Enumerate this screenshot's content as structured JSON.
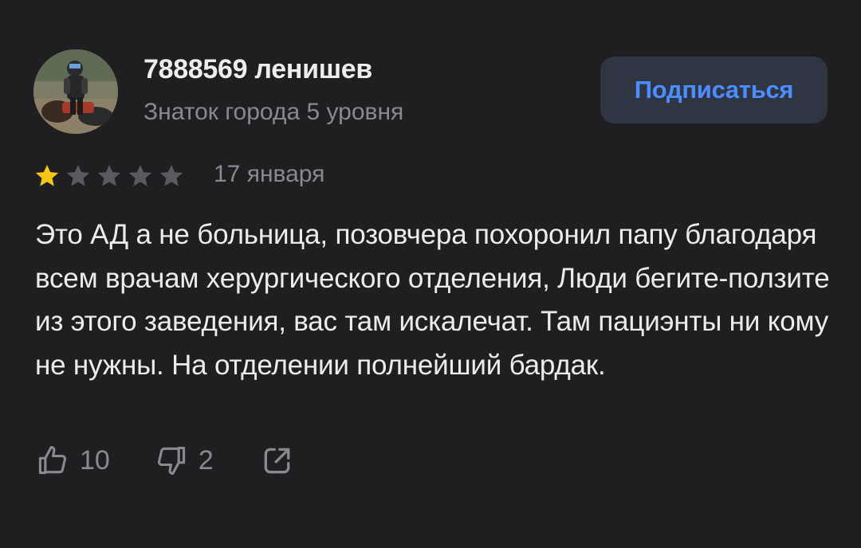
{
  "author": {
    "name": "7888569 ленишев",
    "level": "Знаток города 5 уровня",
    "avatar_icon": "avatar-photo"
  },
  "subscribe": {
    "label": "Подписаться"
  },
  "rating": {
    "value": 1,
    "max": 5,
    "filled_color": "#f5c518",
    "empty_color": "#5a5a5e"
  },
  "review": {
    "date": "17 января",
    "text": "Это АД а не больница, позовчера похоронил папу благодаря всем врачам херургического отделения, Люди бегите-ползите из этого заведения, вас там искалечат. Там пациэнты ни кому не нужны. На отделении полнейший бардак."
  },
  "actions": {
    "likes": "10",
    "dislikes": "2",
    "like_icon": "thumbs-up-icon",
    "dislike_icon": "thumbs-down-icon",
    "share_icon": "share-icon"
  },
  "colors": {
    "background": "#1f1f21",
    "accent": "#4c8dff",
    "muted": "#8a8a8e"
  }
}
